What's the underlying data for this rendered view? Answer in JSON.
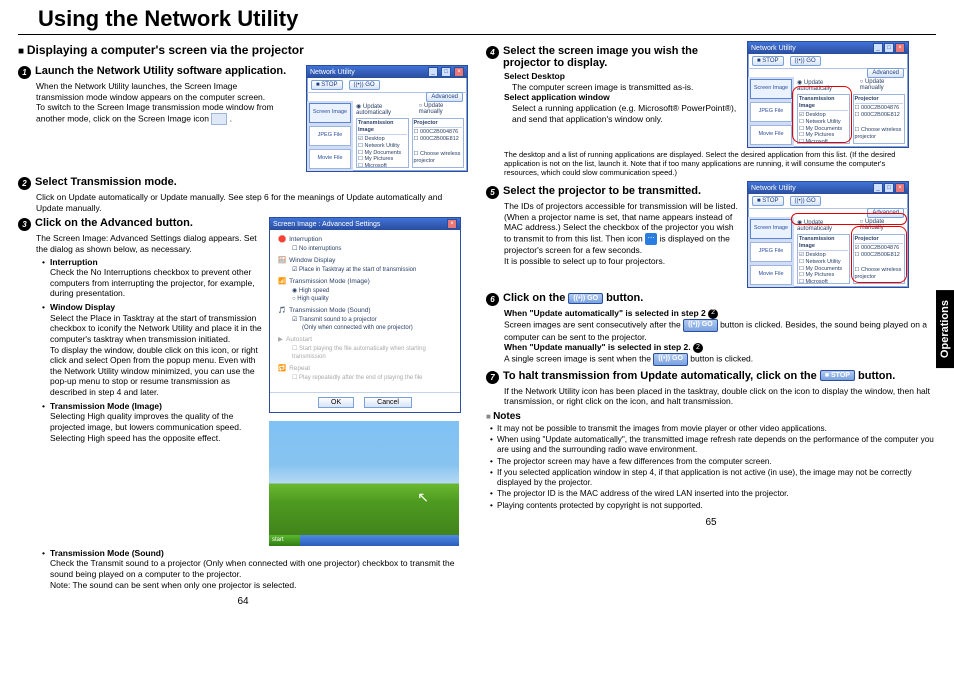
{
  "title": "Using the Network Utility",
  "ops_tab": "Operations",
  "page_left": "64",
  "page_right": "65",
  "left": {
    "section": "Displaying a computer's screen via the projector",
    "step1_title": "Launch the Network Utility software application.",
    "step1_body1": "When the Network Utility launches, the Screen Image transmission mode window appears on the computer screen.",
    "step1_body2": "To switch to the Screen Image transmission mode window from another mode, click on the Screen Image icon ",
    "step1_icon_tail": ".",
    "step2_title": "Select Transmission mode.",
    "step2_body": "Click on Update automatically or Update manually. See step 6 for the meanings of Update automatically and Update manually.",
    "step3_title": "Click on the Advanced button.",
    "step3_intro": "The Screen Image: Advanced Settings dialog appears. Set the dialog as shown below, as necessary.",
    "b_interruption": "Interruption",
    "b_interruption_t": "Check the No Interruptions checkbox to prevent other computers from interrupting the projector, for example, during presentation.",
    "b_window": "Window Display",
    "b_window_t1": "Select the Place in Tasktray at the start of transmission checkbox to iconify the Network Utility and place it in the computer's tasktray when transmission initiated.",
    "b_window_t2": "To display the window, double click on this icon, or right click and select Open from the popup menu. Even with the Network Utility window minimized, you can use the pop-up menu to stop or resume transmission as described in step 4 and later.",
    "b_mode_img": "Transmission Mode (Image)",
    "b_mode_img_t": "Selecting High quality improves the quality of the projected image, but lowers communication speed. Selecting High speed has the opposite effect.",
    "b_mode_snd": "Transmission Mode (Sound)",
    "b_mode_snd_t1": "Check the Transmit sound to a projector (Only when connected with one projector) checkbox to transmit the sound being played on a computer to the projector.",
    "b_mode_snd_t2": "Note: The sound can be sent when only one projector is selected."
  },
  "right": {
    "step4_title": "Select the screen image you wish the projector to display.",
    "step4_sd_h": "Select Desktop",
    "step4_sd": "The computer screen image is transmitted as-is.",
    "step4_aw_h": "Select application window",
    "step4_aw": "Select a running application (e.g. Microsoft® PowerPoint®), and send that application's window only.",
    "step4_tail": "The desktop and a list of running applications are displayed. Select the desired application from this list. (If the desired application is not on the list, launch it. Note that if too many applications are running, it will consume the computer's resources, which could slow communication speed.)",
    "step5_title": "Select the projector to be transmitted.",
    "step5_b1": "The IDs of projectors accessible for transmission will be listed. (When a projector name is set, that name appears instead of MAC address.) Select the checkbox of the projector you wish to transmit to from this list. Then icon ",
    "step5_b2": " is displayed on the projector's screen for a few seconds.",
    "step5_b3": "It is possible to select up to four projectors.",
    "step6_title_a": "Click on the ",
    "step6_title_b": " button.",
    "step6_a1": "When \"Update automatically\" is selected in step 2",
    "step6_a2": "Screen images are sent consecutively after the ",
    "step6_a3": " button is clicked. Besides, the sound being played on a computer can be sent to the projector.",
    "step6_m1": "When \"Update manually\" is selected in step 2.",
    "step6_m2": "A single screen image is sent when the ",
    "step6_m3": " button is clicked.",
    "step7_title_a": "To halt transmission from Update automatically, click on the ",
    "step7_title_b": " button.",
    "step7_body": "If the Network Utility icon has been placed in the tasktray, double click on the icon to display the window, then halt transmission, or right click on the icon, and halt transmission.",
    "notes_h": "Notes",
    "n1": "It may not be possible to transmit the images from movie player or other video applications.",
    "n2": "When using \"Update automatically\", the transmitted image refresh rate depends on the performance of the computer you are using and the surrounding radio wave environment.",
    "n3": "The projector screen may have a few differences from the computer screen.",
    "n4": "If you selected application window in step 4, if that application is not active (in use), the image may not be correctly displayed by the projector.",
    "n5": "The projector ID is the MAC address of the wired LAN inserted into the projector.",
    "n6": "Playing contents protected by copyright is not supported."
  },
  "app": {
    "title": "Network Utility",
    "btn_stop": "■ STOP",
    "btn_go": "((•)) GO",
    "btn_adv": "Advanced",
    "sidebar": [
      "Screen Image",
      "JPEG File",
      "Movie File"
    ],
    "r1": "Update automatically",
    "r2": "Update manually",
    "h1": "Transmission Image",
    "h2": "Projector",
    "t1": [
      "Desktop",
      "Network Utility",
      "My Documents",
      "My Pictures",
      "Microsoft Power…"
    ],
    "t2": [
      "000C2B004876",
      "000C2B00E812"
    ],
    "wl": "Choose wireless projector"
  },
  "adv": {
    "title": "Screen Image : Advanced Settings",
    "g1": "Interruption",
    "g1o": "No interruptions",
    "g2": "Window Display",
    "g2o": "Place in Tasktray at the start of transmission",
    "g3": "Transmission Mode (Image)",
    "g3a": "High speed",
    "g3b": "High quality",
    "g4": "Transmission Mode (Sound)",
    "g4a": "Transmit sound to a projector",
    "g4b": "(Only when connected with one projector)",
    "g5": "Autostart",
    "g5a": "Start playing the file automatically when starting transmission",
    "g6": "Repeat",
    "g6a": "Play repeatedly after the end of playing the file",
    "ok": "OK",
    "cancel": "Cancel"
  },
  "desktop": {
    "start": "start"
  },
  "go_label": "((•)) GO",
  "stop_label": "■ STOP"
}
